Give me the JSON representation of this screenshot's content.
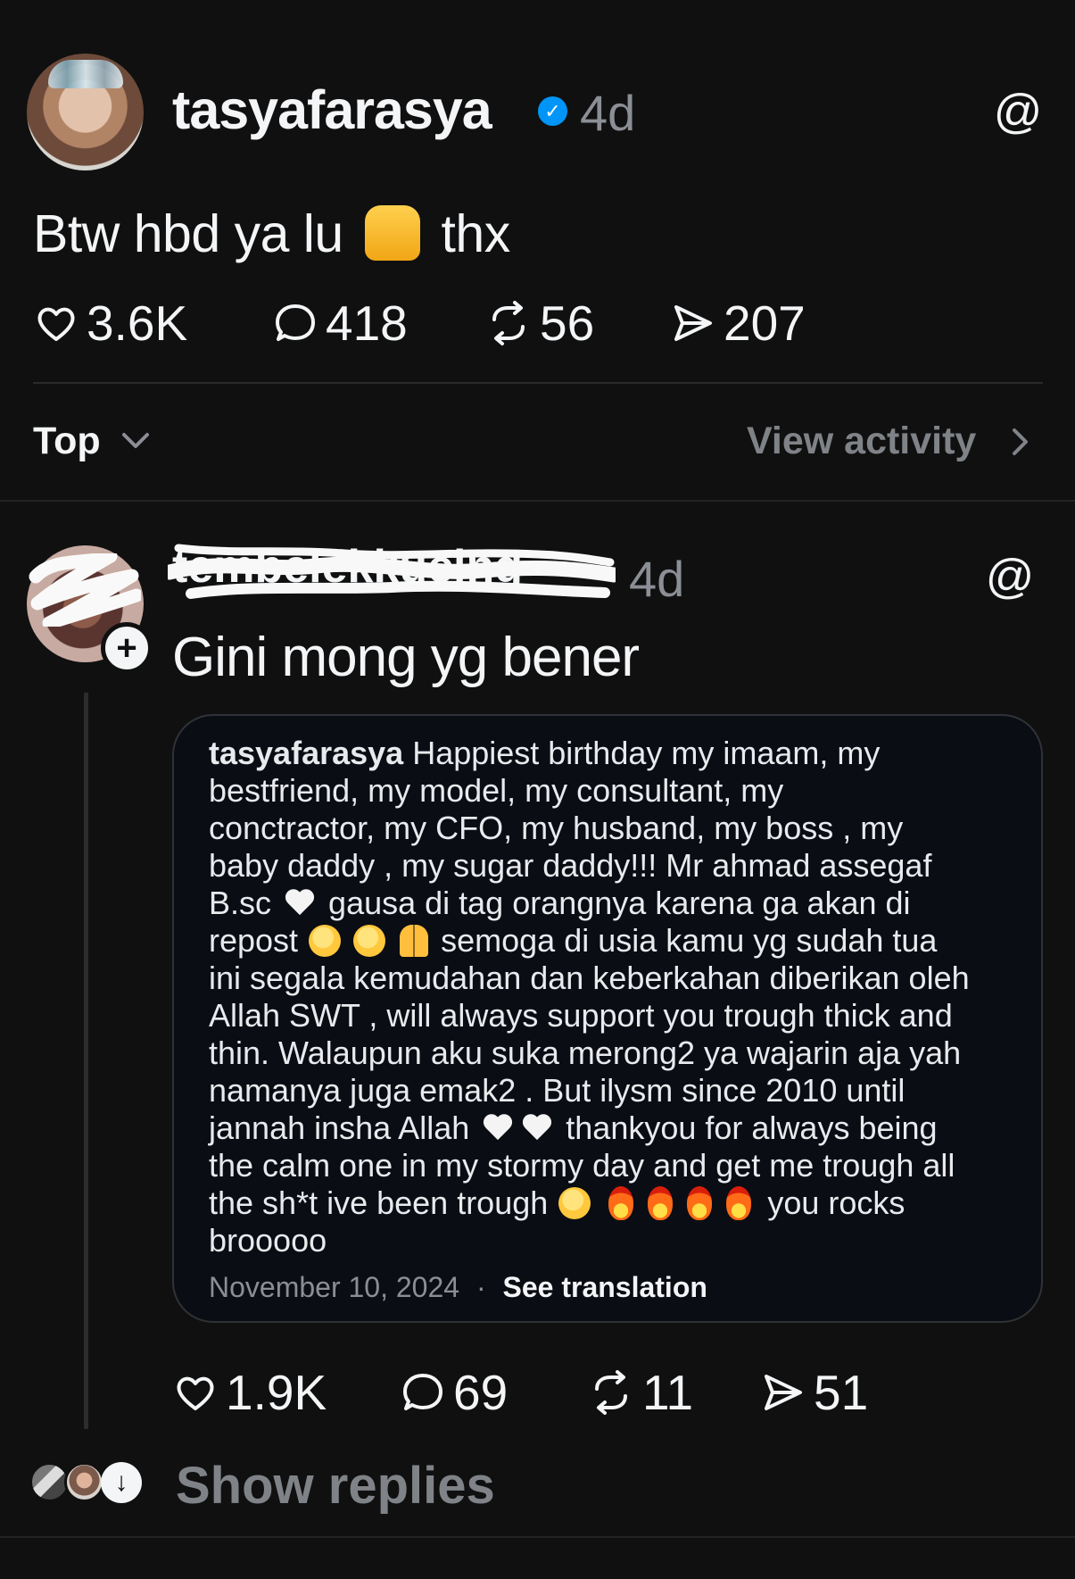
{
  "colors": {
    "background": "#101010",
    "text_primary": "#f3f5f7",
    "text_secondary": "#8b8f95",
    "verified": "#0095f6"
  },
  "original_post": {
    "username": "tasyafarasya",
    "time": "4d",
    "text_before_emoji": "Btw hbd ya lu",
    "text_after_emoji": "thx",
    "likes": "3.6K",
    "replies": "418",
    "reposts": "56",
    "shares": "207"
  },
  "sort": {
    "label": "Top",
    "view_activity": "View activity"
  },
  "reply": {
    "username": "tembelekkucing",
    "time": "4d",
    "text": "Gini mong yg bener",
    "quoted": {
      "username": "tasyafarasya",
      "lines": [
        "Happiest birthday my imaam, my",
        "bestfriend, my model, my consultant, my",
        "conctractor, my CFO, my husband, my boss , my",
        "baby daddy , my sugar daddy!!! Mr ahmad assegaf",
        "B.sc",
        "gausa di tag orangnya karena ga akan di",
        "repost",
        "semoga di usia kamu yg sudah tua",
        "ini segala kemudahan dan keberkahan diberikan oleh",
        "Allah SWT , will always support you trough thick and",
        "thin. Walaupun aku suka merong2 ya wajarin aja yah",
        "namanya juga emak2 . But ilysm since 2010 until",
        "jannah insha Allah",
        "thankyou for always being",
        "the calm one in my stormy day and get me trough all",
        "the sh*t ive been trough",
        "you rocks",
        "brooooo"
      ],
      "date": "November 10, 2024",
      "separator": "·",
      "see_translation": "See translation"
    },
    "likes": "1.9K",
    "replies": "69",
    "reposts": "11",
    "shares": "51"
  },
  "footer": {
    "show_replies": "Show replies"
  },
  "icons": {
    "threads": "threads-icon",
    "heart": "heart-icon",
    "comment": "comment-icon",
    "repost": "repost-icon",
    "share": "share-icon"
  }
}
